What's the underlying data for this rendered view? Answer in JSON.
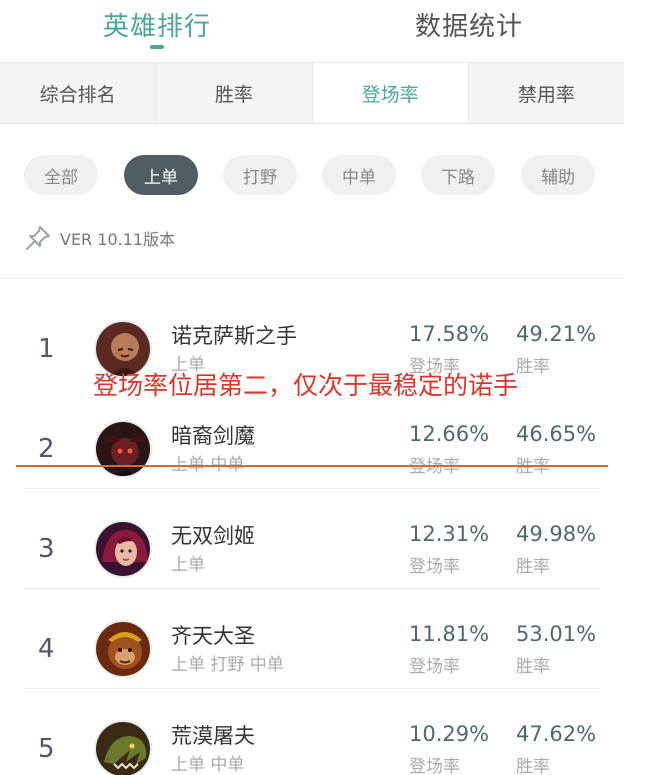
{
  "top_tabs": [
    {
      "label": "英雄排行",
      "active": true
    },
    {
      "label": "数据统计",
      "active": false
    }
  ],
  "sub_tabs": [
    {
      "label": "综合排名",
      "active": false
    },
    {
      "label": "胜率",
      "active": false
    },
    {
      "label": "登场率",
      "active": true
    },
    {
      "label": "禁用率",
      "active": false
    }
  ],
  "filters": [
    {
      "label": "全部",
      "active": false
    },
    {
      "label": "上单",
      "active": true
    },
    {
      "label": "打野",
      "active": false
    },
    {
      "label": "中单",
      "active": false
    },
    {
      "label": "下路",
      "active": false
    },
    {
      "label": "辅助",
      "active": false
    }
  ],
  "version": "VER 10.11版本",
  "rows": [
    {
      "rank": "1",
      "name": "诺克萨斯之手",
      "roles": "上单",
      "pick_rate": "17.58%",
      "pick_label": "登场率",
      "win_rate": "49.21%",
      "win_label": "胜率"
    },
    {
      "rank": "2",
      "name": "暗裔剑魔",
      "roles": "上单 中单",
      "pick_rate": "12.66%",
      "pick_label": "登场率",
      "win_rate": "46.65%",
      "win_label": "胜率"
    },
    {
      "rank": "3",
      "name": "无双剑姬",
      "roles": "上单",
      "pick_rate": "12.31%",
      "pick_label": "登场率",
      "win_rate": "49.98%",
      "win_label": "胜率"
    },
    {
      "rank": "4",
      "name": "齐天大圣",
      "roles": "上单 打野 中单",
      "pick_rate": "11.81%",
      "pick_label": "登场率",
      "win_rate": "53.01%",
      "win_label": "胜率"
    },
    {
      "rank": "5",
      "name": "荒漠屠夫",
      "roles": "上单 中单",
      "pick_rate": "10.29%",
      "pick_label": "登场率",
      "win_rate": "47.62%",
      "win_label": "胜率"
    }
  ],
  "annotation": "登场率位居第二，仅次于最稳定的诺手",
  "colors": {
    "accent": "#4aa89a",
    "chip_active": "#4f5d62",
    "annotation": "#e0342a",
    "underline": "#d66a2a"
  }
}
